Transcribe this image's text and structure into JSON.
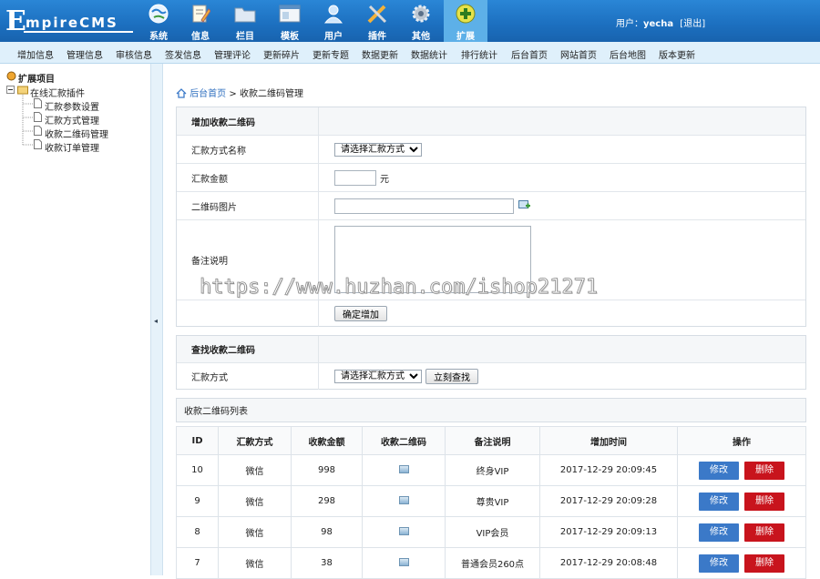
{
  "logo": {
    "letter": "E",
    "rest": "mpireCMS"
  },
  "nav": [
    {
      "label": "系统",
      "icon": "globe-icon"
    },
    {
      "label": "信息",
      "icon": "document-edit-icon"
    },
    {
      "label": "栏目",
      "icon": "folder-icon"
    },
    {
      "label": "模板",
      "icon": "template-window-icon"
    },
    {
      "label": "用户",
      "icon": "user-icon"
    },
    {
      "label": "插件",
      "icon": "tools-icon"
    },
    {
      "label": "其他",
      "icon": "gear-icon"
    },
    {
      "label": "扩展",
      "icon": "plus-circle-icon",
      "active": true
    }
  ],
  "user": {
    "prefix": "用户：",
    "name": "yecha",
    "logout": "[退出]"
  },
  "menu": [
    "增加信息",
    "管理信息",
    "审核信息",
    "签发信息",
    "管理评论",
    "更新碎片",
    "更新专题",
    "数据更新",
    "数据统计",
    "排行统计",
    "后台首页",
    "网站首页",
    "后台地图",
    "版本更新"
  ],
  "tree": {
    "root": "扩展项目",
    "folder": "在线汇款插件",
    "items": [
      "汇款参数设置",
      "汇款方式管理",
      "收款二维码管理",
      "收款订单管理"
    ]
  },
  "breadcrumb": {
    "home": "后台首页",
    "sep": ">",
    "current": "收款二维码管理"
  },
  "add_form": {
    "title": "增加收款二维码",
    "method_label": "汇款方式名称",
    "method_value": "请选择汇款方式",
    "amount_label": "汇款金额",
    "amount_unit": "元",
    "qrcode_label": "二维码图片",
    "note_label": "备注说明",
    "submit": "确定增加"
  },
  "search_form": {
    "title": "查找收款二维码",
    "method_label": "汇款方式",
    "method_value": "请选择汇款方式",
    "submit": "立刻查找"
  },
  "list": {
    "title": "收款二维码列表",
    "columns": [
      "ID",
      "汇款方式",
      "收款金额",
      "收款二维码",
      "备注说明",
      "增加时间",
      "操作"
    ],
    "rows": [
      {
        "id": "10",
        "method": "微信",
        "amount": "998",
        "note": "终身VIP",
        "time": "2017-12-29 20:09:45"
      },
      {
        "id": "9",
        "method": "微信",
        "amount": "298",
        "note": "尊贵VIP",
        "time": "2017-12-29 20:09:28"
      },
      {
        "id": "8",
        "method": "微信",
        "amount": "98",
        "note": "VIP会员",
        "time": "2017-12-29 20:09:13"
      },
      {
        "id": "7",
        "method": "微信",
        "amount": "38",
        "note": "普通会员260点",
        "time": "2017-12-29 20:08:48"
      }
    ],
    "edit_label": "修改",
    "delete_label": "删除"
  },
  "splitter_arrow": "◂",
  "watermark": "https://www.huzhan.com/ishop21271"
}
